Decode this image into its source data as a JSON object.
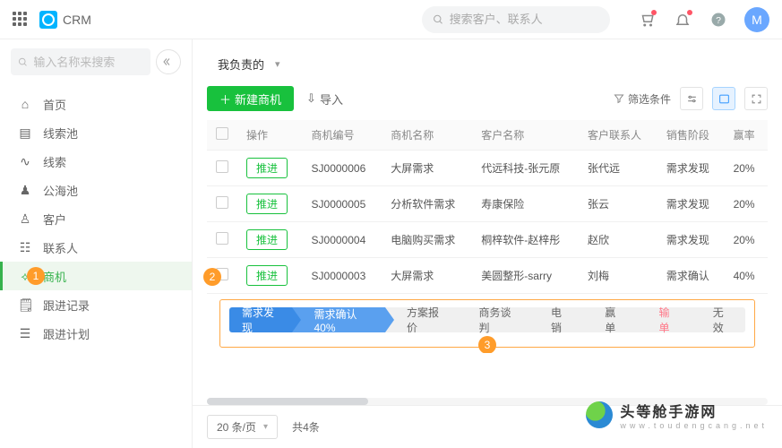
{
  "topbar": {
    "app_name": "CRM",
    "search_placeholder": "搜索客户、联系人",
    "avatar_letter": "M"
  },
  "sidebar": {
    "search_placeholder": "输入名称来搜索",
    "items": [
      {
        "icon": "⌂",
        "label": "首页"
      },
      {
        "icon": "▤",
        "label": "线索池"
      },
      {
        "icon": "∿",
        "label": "线索"
      },
      {
        "icon": "♟",
        "label": "公海池"
      },
      {
        "icon": "♙",
        "label": "客户"
      },
      {
        "icon": "☷",
        "label": "联系人"
      },
      {
        "icon": "⟡",
        "label": "商机",
        "active": true
      },
      {
        "icon": "🗒",
        "label": "跟进记录"
      },
      {
        "icon": "☰",
        "label": "跟进计划"
      }
    ]
  },
  "markers": {
    "one": "1",
    "two": "2",
    "three": "3"
  },
  "main": {
    "scope_label": "我负责的",
    "new_btn": "新建商机",
    "import_btn": "导入",
    "filter_label": "筛选条件",
    "columns": [
      "操作",
      "商机编号",
      "商机名称",
      "客户名称",
      "客户联系人",
      "销售阶段",
      "赢率"
    ],
    "push_label": "推进",
    "rows": [
      {
        "code": "SJ0000006",
        "name": "大屏需求",
        "customer": "代远科技-张元原",
        "contact": "张代远",
        "stage": "需求发现",
        "rate": "20%"
      },
      {
        "code": "SJ0000005",
        "name": "分析软件需求",
        "customer": "寿康保险",
        "contact": "张云",
        "stage": "需求发现",
        "rate": "20%"
      },
      {
        "code": "SJ0000004",
        "name": "电脑购买需求",
        "customer": "桐梓软件-赵梓彤",
        "contact": "赵欣",
        "stage": "需求发现",
        "rate": "20%"
      },
      {
        "code": "SJ0000003",
        "name": "大屏需求",
        "customer": "美圆整形-sarry",
        "contact": "刘梅",
        "stage": "需求确认",
        "rate": "40%"
      }
    ],
    "stages": [
      {
        "cls": "a1",
        "label": "需求发现"
      },
      {
        "cls": "a2",
        "label": "需求确认 40%"
      },
      {
        "cls": "",
        "label": "方案报价"
      },
      {
        "cls": "",
        "label": "商务谈判"
      },
      {
        "cls": "",
        "label": "电销"
      },
      {
        "cls": "",
        "label": "赢单"
      },
      {
        "cls": "lose",
        "label": "输单"
      },
      {
        "cls": "",
        "label": "无效"
      }
    ]
  },
  "footer": {
    "page_size": "20 条/页",
    "total": "共4条"
  },
  "watermark": {
    "title": "头等舱手游网",
    "url": "www.toudengcang.net"
  }
}
